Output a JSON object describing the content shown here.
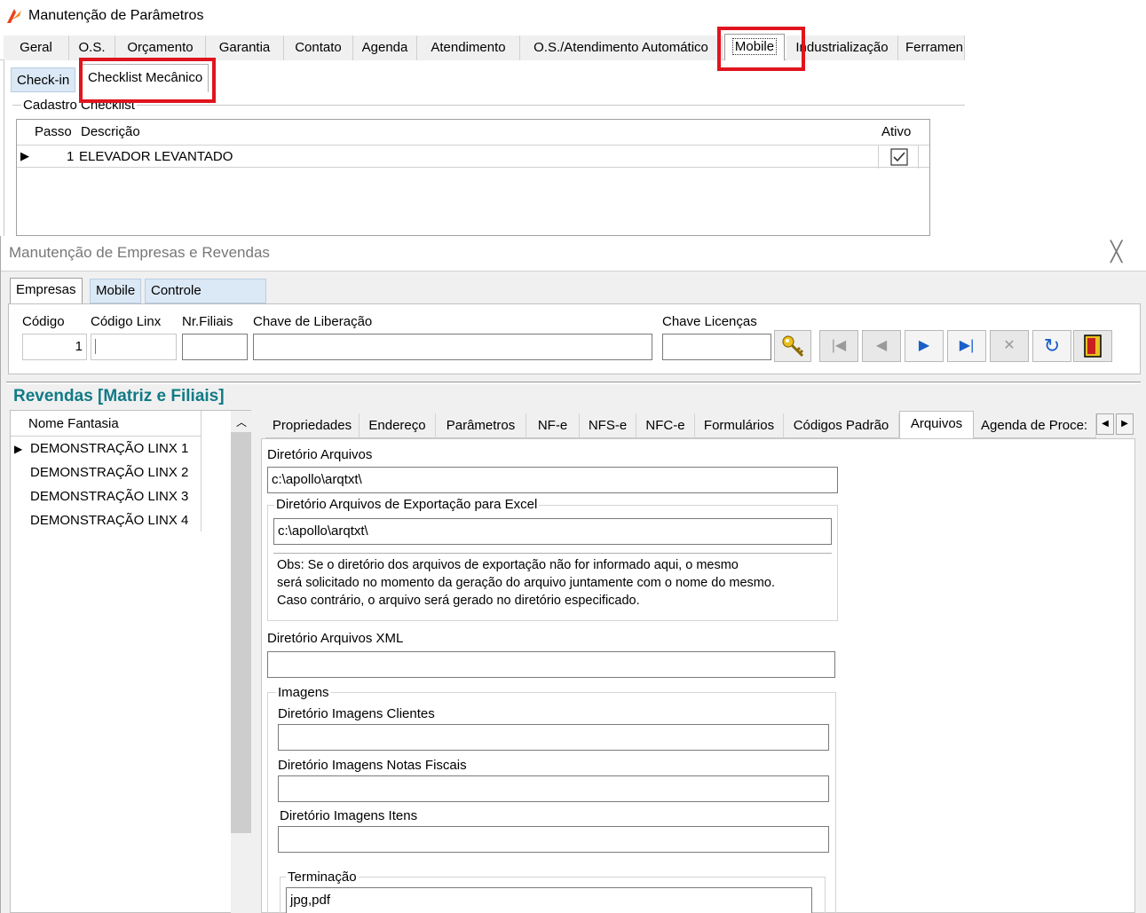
{
  "win1": {
    "title": "Manutenção de Parâmetros",
    "tabs": [
      "Geral",
      "O.S.",
      "Orçamento",
      "Garantia",
      "Contato",
      "Agenda",
      "Atendimento",
      "O.S./Atendimento Automático",
      "Mobile",
      "Industrialização",
      "Ferramen"
    ],
    "selected_tab": "Mobile",
    "subtabs": [
      "Check-in",
      "Checklist Mecânico"
    ],
    "selected_subtab": "Checklist Mecânico",
    "group_title": "Cadastro Checklist",
    "grid": {
      "columns": [
        "Passo",
        "Descrição",
        "Ativo"
      ],
      "rows": [
        {
          "passo": "1",
          "descricao": "ELEVADOR LEVANTADO",
          "ativo": true
        }
      ]
    }
  },
  "win2": {
    "title": "Manutenção de Empresas e Revendas",
    "close_glyph": "╳",
    "tabs": [
      "Empresas",
      "Mobile",
      "Controle Versão/Certificado"
    ],
    "selected_tab": "Empresas",
    "fields": {
      "codigo_label": "Código",
      "codigo_value": "1",
      "codigo_linx_label": "Código Linx",
      "nr_filiais_label": "Nr.Filiais",
      "chave_liberacao_label": "Chave de Liberação",
      "chave_licencas_label": "Chave Licenças"
    },
    "nav_buttons": [
      "key-icon",
      "first-record-icon",
      "prior-record-icon",
      "next-record-icon",
      "last-record-icon",
      "cancel-icon",
      "refresh-icon",
      "exit-icon"
    ],
    "section_title": "Revendas [Matriz e Filiais]",
    "list": {
      "header": "Nome Fantasia",
      "rows": [
        "DEMONSTRAÇÃO LINX 1",
        "DEMONSTRAÇÃO LINX 2",
        "DEMONSTRAÇÃO LINX 3",
        "DEMONSTRAÇÃO LINX 4"
      ]
    },
    "right_tabs": [
      "Propriedades",
      "Endereço",
      "Parâmetros",
      "NF-e",
      "NFS-e",
      "NFC-e",
      "Formulários",
      "Códigos Padrão",
      "Arquivos",
      "Agenda de Proce:"
    ],
    "selected_right_tab": "Arquivos",
    "arquivos": {
      "dir_arquivos_label": "Diretório Arquivos",
      "dir_arquivos_value": "c:\\apollo\\arqtxt\\",
      "dir_excel_label": "Diretório Arquivos de Exportação para Excel",
      "dir_excel_value": "c:\\apollo\\arqtxt\\",
      "obs_line1": "Obs: Se o diretório dos arquivos de exportação não  for informado aqui, o  mesmo",
      "obs_line2": "será solicitado no momento da geração do arquivo juntamente com o nome do mesmo.",
      "obs_line3": "Caso contrário,  o arquivo será gerado no diretório especificado.",
      "dir_xml_label": "Diretório Arquivos XML",
      "dir_xml_value": "",
      "imagens_title": "Imagens",
      "img_clientes_label": "Diretório Imagens Clientes",
      "img_notas_label": "Diretório Imagens Notas Fiscais",
      "img_itens_label": "Diretório Imagens Itens",
      "terminacao_label": "Terminação",
      "terminacao_value": "jpg,pdf"
    }
  },
  "highlight_color": "#e0141e"
}
